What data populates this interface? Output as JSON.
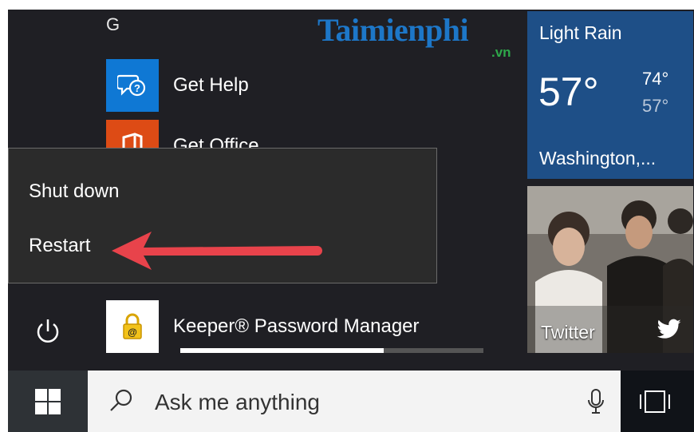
{
  "apps": {
    "section_letter": "G",
    "get_help": {
      "label": "Get Help",
      "color": "#0f78d4"
    },
    "get_office": {
      "label": "Get Office",
      "color": "#dd4b15"
    },
    "keeper": {
      "label": "Keeper® Password Manager",
      "progress": 0.67
    }
  },
  "watermark": {
    "main": "Taimienphi",
    "sub": ".vn"
  },
  "power_menu": {
    "shut_down": "Shut down",
    "restart": "Restart"
  },
  "tiles": {
    "weather": {
      "condition": "Light Rain",
      "temp": "57°",
      "high": "74°",
      "low": "57°",
      "city": "Washington,...",
      "color": "#1e4f87"
    },
    "twitter": {
      "label": "Twitter"
    }
  },
  "taskbar": {
    "search_placeholder": "Ask me anything"
  },
  "colors": {
    "start_bg": "#1f1f24",
    "arrow": "#e8434b"
  }
}
